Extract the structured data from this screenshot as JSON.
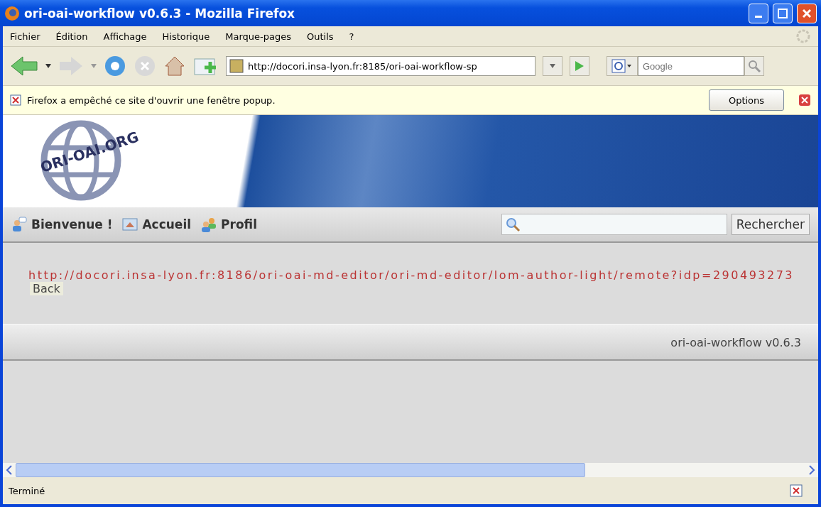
{
  "window": {
    "title": "ori-oai-workflow v0.6.3 - Mozilla Firefox"
  },
  "menu": [
    "Fichier",
    "Édition",
    "Affichage",
    "Historique",
    "Marque-pages",
    "Outils",
    "?"
  ],
  "toolbar": {
    "url": "http://docori.insa-lyon.fr:8185/ori-oai-workflow-sp",
    "search_placeholder": "Google"
  },
  "notification": {
    "message": "Firefox a empêché ce site d'ouvrir une fenêtre popup.",
    "button": "Options"
  },
  "site": {
    "logo": "ORI-OAI.ORG",
    "nav": [
      {
        "label": "Bienvenue !",
        "kind": "user"
      },
      {
        "label": "Accueil",
        "kind": "home"
      },
      {
        "label": "Profil",
        "kind": "group"
      }
    ],
    "search_button": "Rechercher",
    "link": "http://docori.insa-lyon.fr:8186/ori-oai-md-editor/ori-md-editor/lom-author-light/remote?idp=290493273",
    "back": "Back",
    "footer": "ori-oai-workflow v0.6.3"
  },
  "status_bar": {
    "text": "Terminé"
  }
}
